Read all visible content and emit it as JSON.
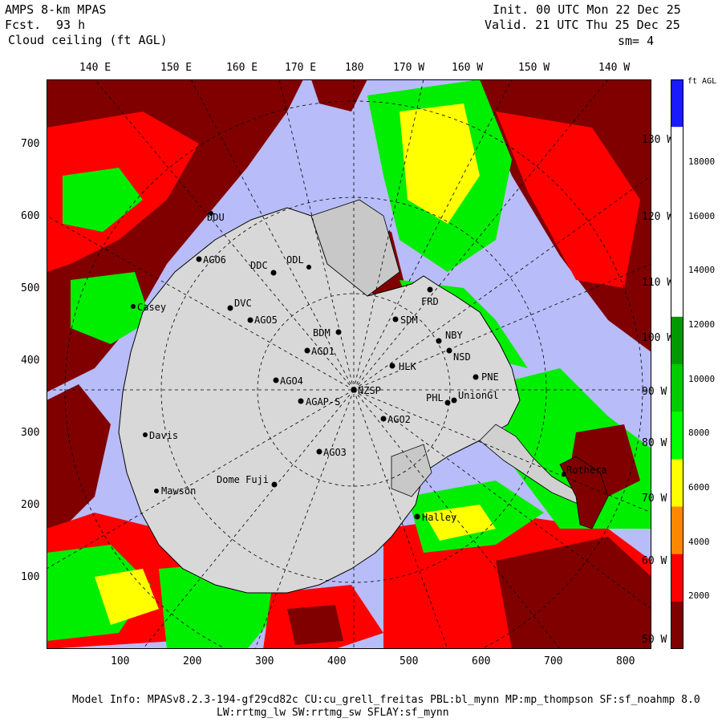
{
  "header": {
    "model": "AMPS 8-km MPAS",
    "fcst_label": "Fcst.",
    "fcst_hours": "93 h",
    "field": "Cloud ceiling (ft AGL)",
    "init": "Init. 00 UTC Mon 22 Dec 25",
    "valid": "Valid. 21 UTC Thu 25 Dec 25",
    "smooth": "sm= 4"
  },
  "top_lon_labels": [
    "140 E",
    "150 E",
    "160 E",
    "170 E",
    "180",
    "170 W",
    "160 W",
    "150 W",
    "140 W"
  ],
  "right_lon_labels": [
    "130 W",
    "120 W",
    "110 W",
    "100 W",
    "90 W",
    "80 W",
    "70 W",
    "60 W",
    "50 W"
  ],
  "left_y_ticks": [
    "700",
    "600",
    "500",
    "400",
    "300",
    "200",
    "100"
  ],
  "bottom_x_ticks": [
    "100",
    "200",
    "300",
    "400",
    "500",
    "600",
    "700",
    "800"
  ],
  "colorbar": {
    "unit": "ft AGL",
    "tick_labels": [
      "18000",
      "16000",
      "14000",
      "12000",
      "10000",
      "8000",
      "6000",
      "4000",
      "2000"
    ],
    "colors": [
      "#1a1aff",
      "#ffffff",
      "#ffffff",
      "#ffffff",
      "#ffffff",
      "#009900",
      "#00cc00",
      "#00ff00",
      "#ffff00",
      "#ff8800",
      "#ff0000",
      "#800000"
    ]
  },
  "stations": [
    {
      "name": "DDU"
    },
    {
      "name": "AGO6"
    },
    {
      "name": "DDC"
    },
    {
      "name": "ODL"
    },
    {
      "name": "Casey"
    },
    {
      "name": "DVC"
    },
    {
      "name": "AGO5"
    },
    {
      "name": "BDM"
    },
    {
      "name": "SDM"
    },
    {
      "name": "FRD"
    },
    {
      "name": "NBY"
    },
    {
      "name": "NSD"
    },
    {
      "name": "AGO1"
    },
    {
      "name": "HLK"
    },
    {
      "name": "PNE"
    },
    {
      "name": "AGO4"
    },
    {
      "name": "NZSP"
    },
    {
      "name": "AGAP-S"
    },
    {
      "name": "PHL"
    },
    {
      "name": "UnionGl"
    },
    {
      "name": "AGO2"
    },
    {
      "name": "AGO3"
    },
    {
      "name": "Davis"
    },
    {
      "name": "Dome Fuji"
    },
    {
      "name": "Mawson"
    },
    {
      "name": "Halley"
    },
    {
      "name": "Rothera"
    }
  ],
  "footer": {
    "line1": "Model Info: MPASv8.2.3-194-gf29cd82c CU:cu_grell_freitas PBL:bl_mynn MP:mp_thompson SF:sf_noahmp 8.0",
    "line2": "LW:rrtmg_lw SW:rrtmg_sw SFLAY:sf_mynn"
  }
}
